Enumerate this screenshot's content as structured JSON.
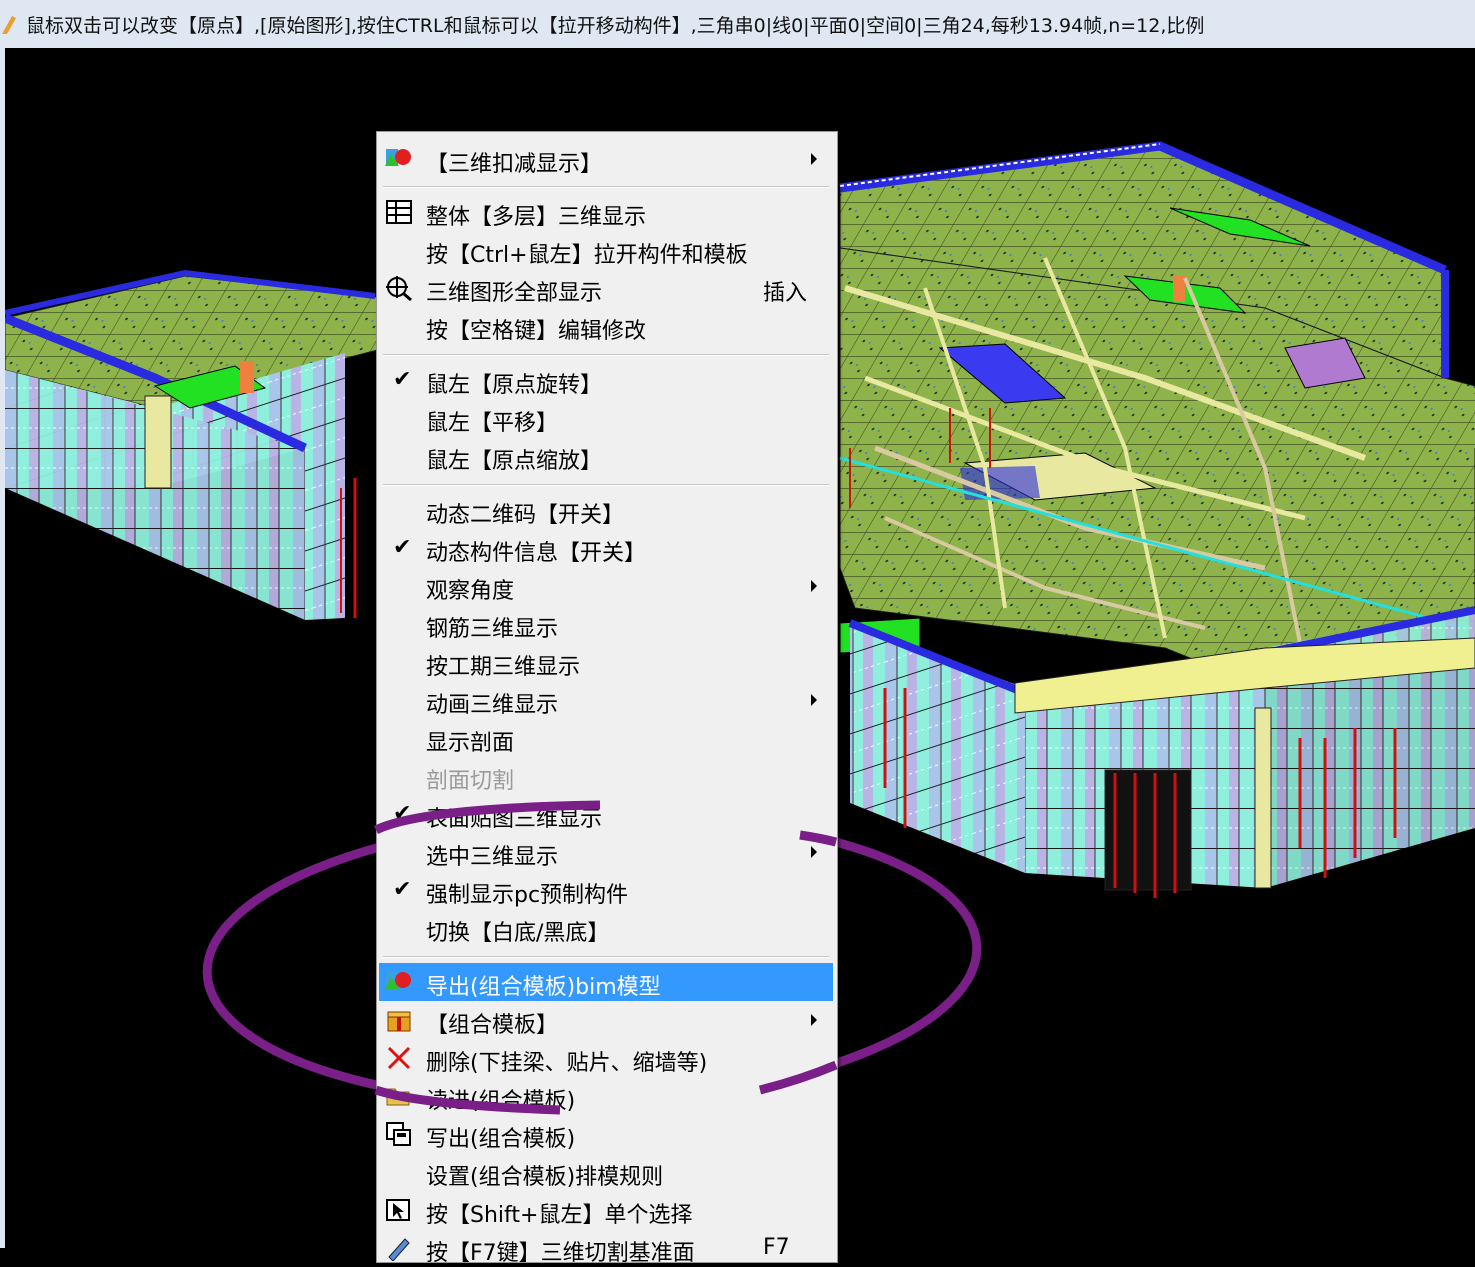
{
  "window": {
    "title": "鼠标双击可以改变【原点】,[原始图形],按住CTRL和鼠标可以【拉开移动构件】,三角串0|线0|平面0|空间0|三角24,每秒13.94帧,n=12,比例"
  },
  "menu": {
    "items": [
      {
        "label": "【三维扣减显示】",
        "icon": "colored-shapes-icon",
        "submenu": true
      },
      {
        "label": "整体【多层】三维显示",
        "icon": "table-grid-icon"
      },
      {
        "label": "按【Ctrl+鼠左】拉开构件和模板"
      },
      {
        "label": "三维图形全部显示",
        "icon": "zoom-target-icon",
        "shortcut": "插入"
      },
      {
        "label": "按【空格键】编辑修改"
      },
      {
        "label": "鼠左【原点旋转】",
        "checked": true
      },
      {
        "label": "鼠左【平移】"
      },
      {
        "label": "鼠左【原点缩放】"
      },
      {
        "label": "动态二维码【开关】"
      },
      {
        "label": "动态构件信息【开关】",
        "checked": true
      },
      {
        "label": "观察角度",
        "submenu": true
      },
      {
        "label": "钢筋三维显示"
      },
      {
        "label": "按工期三维显示"
      },
      {
        "label": "动画三维显示",
        "submenu": true
      },
      {
        "label": "显示剖面"
      },
      {
        "label": "剖面切割",
        "disabled": true
      },
      {
        "label": "表面贴图三维显示",
        "checked": true
      },
      {
        "label": "选中三维显示",
        "submenu": true
      },
      {
        "label": "强制显示pc预制构件",
        "checked": true
      },
      {
        "label": "切换【白底/黑底】"
      },
      {
        "label": "导出(组合模板)bim模型",
        "icon": "colored-shapes-icon",
        "highlighted": true
      },
      {
        "label": "【组合模板】",
        "icon": "gift-box-icon",
        "submenu": true
      },
      {
        "label": "删除(下挂梁、贴片、缩墙等)",
        "icon": "red-x-icon"
      },
      {
        "label": "读进(组合模板)",
        "icon": "folder-open-icon"
      },
      {
        "label": "写出(组合模板)",
        "icon": "save-copy-icon"
      },
      {
        "label": "设置(组合模板)排模规则"
      },
      {
        "label": "按【Shift+鼠左】单个选择",
        "icon": "cursor-select-icon"
      },
      {
        "label": "按【F7键】三维切割基准面",
        "icon": "pencil-cut-icon",
        "shortcut": "F7"
      }
    ]
  },
  "colors": {
    "menu_background": "#f0f0f0",
    "highlight": "#3399ff",
    "annotation_ellipse": "#7a1f87",
    "viewport_background": "#000000",
    "slab": "#8db34a",
    "wall": "#8ef0dc",
    "beam": "#2a2ae0"
  }
}
